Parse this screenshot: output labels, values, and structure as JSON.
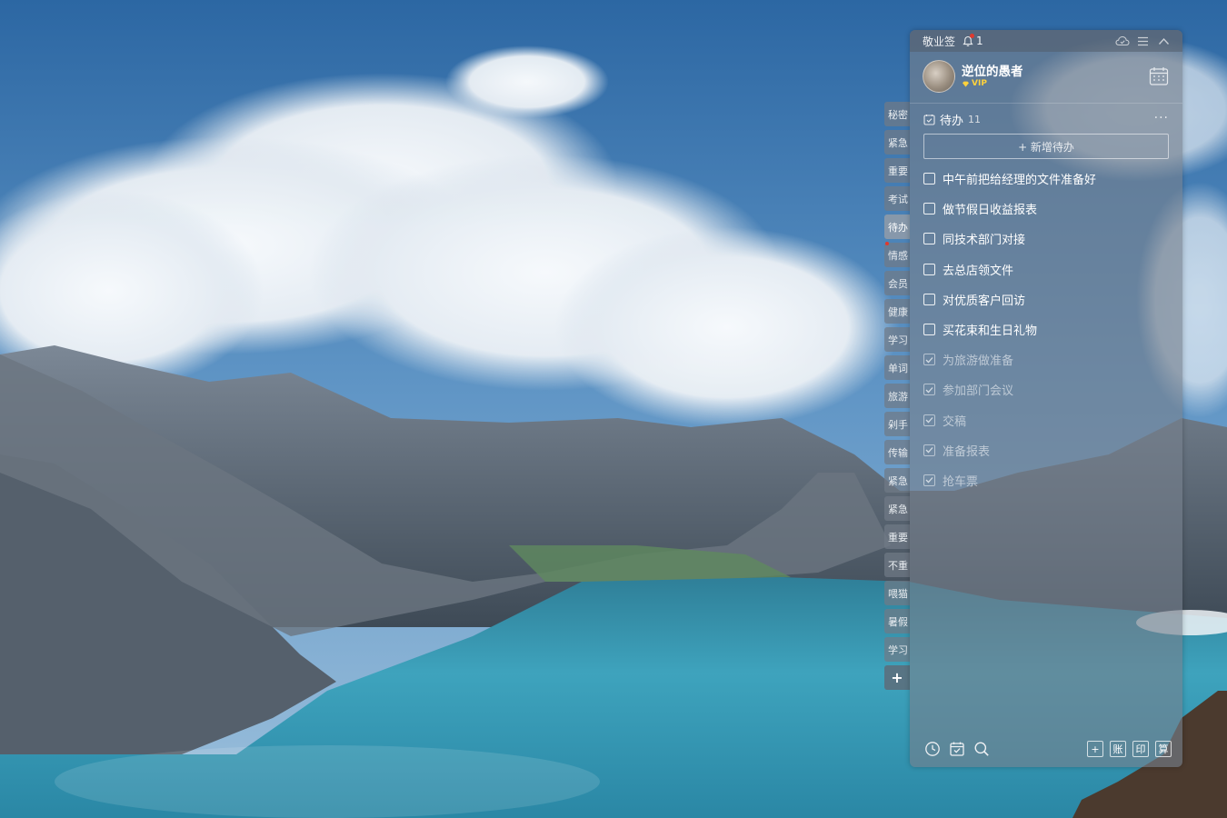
{
  "app": {
    "title": "敬业签",
    "notification_count": "1"
  },
  "user": {
    "name": "逆位的愚者",
    "badge": "VIP"
  },
  "todo": {
    "title": "待办",
    "count": "11",
    "more": "···",
    "add_label": "+ 新增待办",
    "items": [
      {
        "text": "中午前把给经理的文件准备好",
        "done": false
      },
      {
        "text": "做节假日收益报表",
        "done": false
      },
      {
        "text": "同技术部门对接",
        "done": false
      },
      {
        "text": "去总店领文件",
        "done": false
      },
      {
        "text": "对优质客户回访",
        "done": false
      },
      {
        "text": "买花束和生日礼物",
        "done": false
      },
      {
        "text": "为旅游做准备",
        "done": true
      },
      {
        "text": "参加部门会议",
        "done": true
      },
      {
        "text": "交稿",
        "done": true
      },
      {
        "text": "准备报表",
        "done": true
      },
      {
        "text": "抢车票",
        "done": true
      }
    ]
  },
  "tabs": [
    "秘密",
    "紧急",
    "重要",
    "考试",
    "待办",
    "情感",
    "会员",
    "健康",
    "学习",
    "单词",
    "旅游",
    "剁手",
    "传输",
    "紧急",
    "紧急",
    "重要",
    "不重",
    "喂猫",
    "暑假",
    "学习"
  ],
  "active_tab": "待办",
  "tab_add": "+",
  "bottom": {
    "tool_account": "账",
    "tool_print": "印",
    "tool_calc": "算",
    "tool_add": "+"
  },
  "icons": {
    "bell": "bell-icon",
    "cloud": "cloud-sync-icon",
    "menu": "menu-icon",
    "collapse": "chevron-up-icon",
    "calendar": "calendar-icon",
    "todo": "todo-check-icon",
    "clock": "clock-icon",
    "check_calendar": "calendar-check-icon",
    "search": "search-icon"
  },
  "colors": {
    "accent_vip": "#ffd23c",
    "notification_dot": "#e0392e"
  }
}
